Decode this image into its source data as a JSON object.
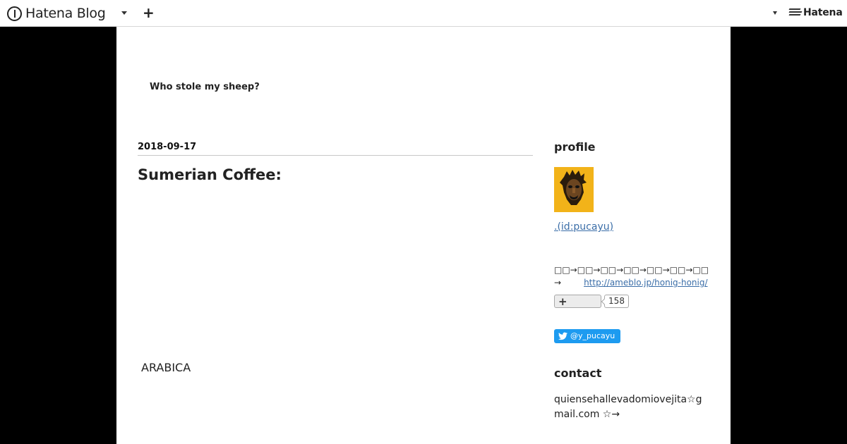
{
  "header": {
    "logo_text": "Hatena Blog",
    "add_label": "+",
    "hatena_text": "Hatena"
  },
  "blog": {
    "title": "Who stole my sheep?"
  },
  "article": {
    "date": "2018-09-17",
    "title": "Sumerian Coffee:",
    "body_word": "ARABICA"
  },
  "sidebar": {
    "profile_heading": "profile",
    "profile_link": ".(id:pucayu)",
    "profile_desc_line1": "□□→□□→□□→□□→□□→□□→□□",
    "profile_desc_arrow": "→",
    "profile_url": "http://ameblo.jp/honig-honig/",
    "follow_plus": "+",
    "follower_count": "158",
    "twitter_label": "@y_pucayu",
    "contact_heading": "contact",
    "contact_text": "quiensehallevadomiovejita☆gmail.com ☆→"
  },
  "colors": {
    "link": "#3b6ea8",
    "twitter": "#1d9bf0",
    "avatar_bg": "#f2b319"
  }
}
